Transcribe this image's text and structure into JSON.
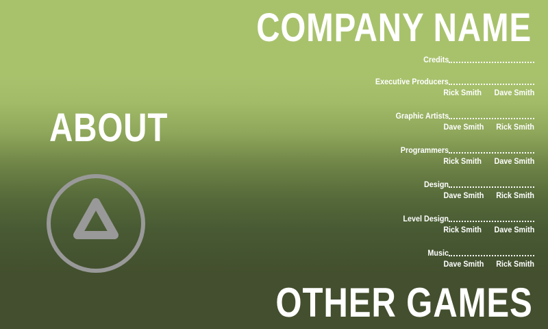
{
  "header": {
    "company_name": "COMPANY NAME"
  },
  "menu": {
    "about_label": "ABOUT",
    "other_games_label": "OTHER GAMES"
  },
  "credits": {
    "title": "Credits",
    "groups": [
      {
        "role": "Executive Producers",
        "names": [
          "Rick Smith",
          "Dave Smith"
        ]
      },
      {
        "role": "Graphic Artists",
        "names": [
          "Dave Smith",
          "Rick Smith"
        ]
      },
      {
        "role": "Programmers",
        "names": [
          "Rick Smith",
          "Dave Smith"
        ]
      },
      {
        "role": "Design",
        "names": [
          "Dave Smith",
          "Rick Smith"
        ]
      },
      {
        "role": "Level Design",
        "names": [
          "Rick Smith",
          "Dave Smith"
        ]
      },
      {
        "role": "Music",
        "names": [
          "Dave Smith",
          "Rick Smith"
        ]
      }
    ]
  },
  "icons": {
    "back_button": "triangle-back-icon"
  },
  "colors": {
    "background_top": "#a8c26c",
    "background_bottom": "#434f2e",
    "icon_gray": "#999999",
    "text": "#ffffff"
  }
}
